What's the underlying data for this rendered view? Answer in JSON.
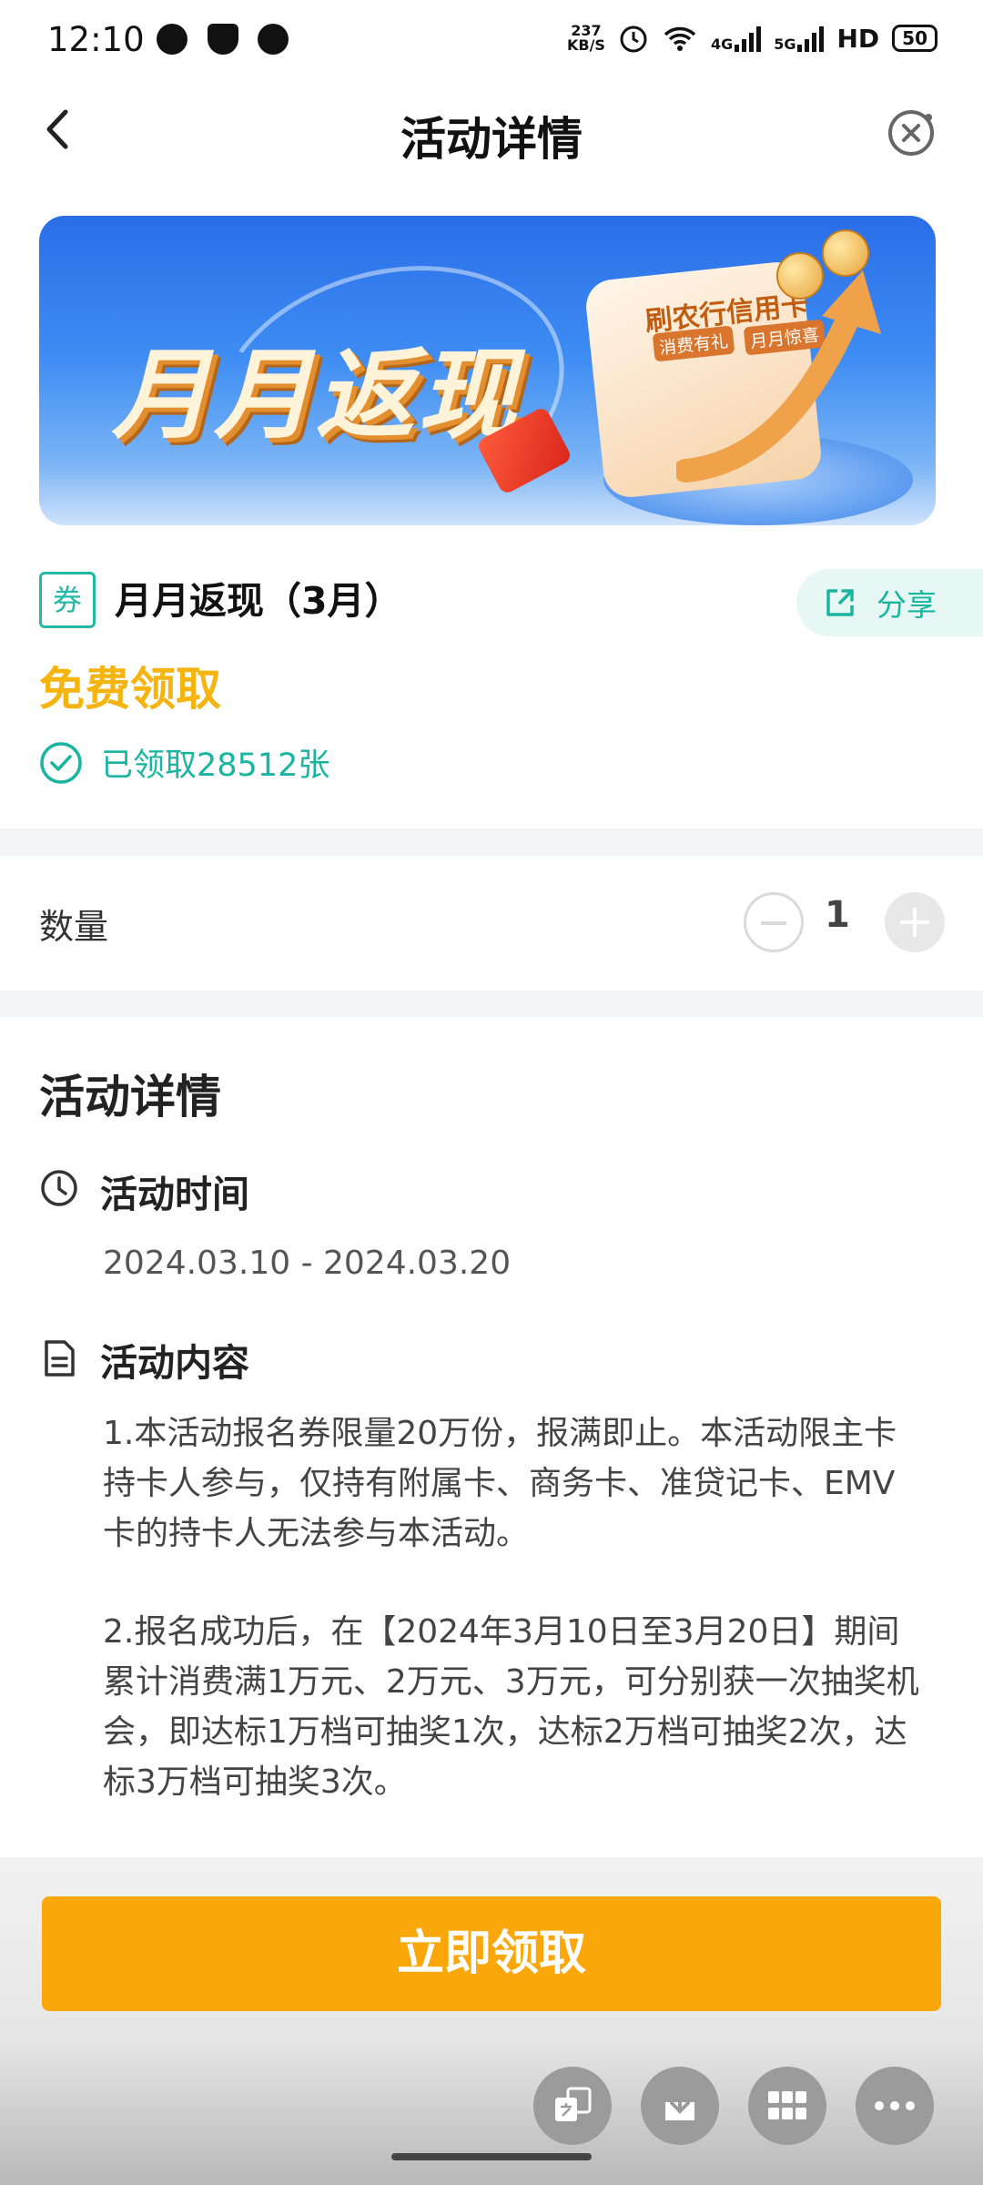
{
  "status_bar": {
    "time": "12:10",
    "net_speed_top": "237",
    "net_speed_bottom": "KB/S",
    "sig1_label": "4G",
    "sig2_label": "5G",
    "hd_label": "HD",
    "battery": "50"
  },
  "header": {
    "title": "活动详情"
  },
  "banner": {
    "headline": "月月返现",
    "card_title": "刷农行信用卡",
    "tag1": "消费有礼",
    "tag2": "月月惊喜"
  },
  "coupon": {
    "tag": "券",
    "name": "月月返现（3月）",
    "share_label": "分享",
    "price_label": "免费领取",
    "claimed_text": "已领取28512张"
  },
  "quantity": {
    "label": "数量",
    "value": "1"
  },
  "details": {
    "title": "活动详情",
    "time_title": "活动时间",
    "time_value": "2024.03.10 - 2024.03.20",
    "content_title": "活动内容",
    "para1": "1.本活动报名券限量20万份，报满即止。本活动限主卡持卡人参与，仅持有附属卡、商务卡、准贷记卡、EMV卡的持卡人无法参与本活动。",
    "para2": "2.报名成功后，在【2024年3月10日至3月20日】期间累计消费满1万元、2万元、3万元，可分别获一次抽奖机会，即达标1万档可抽奖1次，达标2万档可抽奖2次，达标3万档可抽奖3次。"
  },
  "cta": {
    "label": "立即领取"
  },
  "colors": {
    "accent": "#1ab5a1",
    "price": "#f5b40f",
    "cta": "#f9a70b"
  },
  "floating_icons": [
    "translate-icon",
    "download-icon",
    "grid-icon",
    "more-icon"
  ]
}
